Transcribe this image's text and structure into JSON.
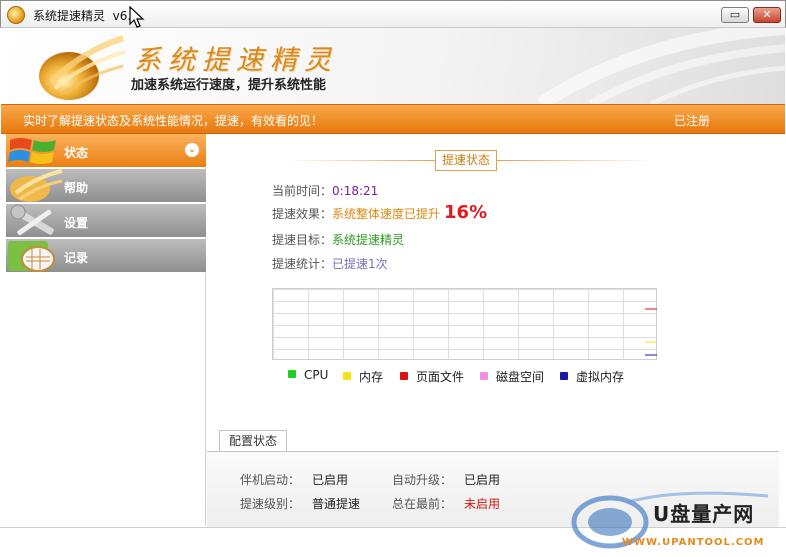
{
  "window": {
    "title": "系统提速精灵",
    "version": "v6.",
    "minimize_label": "▭",
    "close_label": "✕"
  },
  "banner": {
    "brand_calligraphy": "系统提速精灵",
    "tagline": "加速系统运行速度，提升系统性能"
  },
  "infobar": {
    "message": "实时了解提速状态及系统性能情况，提速，有效看的见！",
    "registration": "已注册"
  },
  "sidebar": {
    "items": [
      {
        "label": "状态",
        "active": true
      },
      {
        "label": "帮助",
        "active": false
      },
      {
        "label": "设置",
        "active": false
      },
      {
        "label": "记录",
        "active": false
      }
    ]
  },
  "status": {
    "tag": "提速状态",
    "time_label": "当前时间：",
    "time_value": "0:18:21",
    "effect_label": "提速效果：",
    "effect_value": "系统整体速度已提升",
    "effect_percent": "16%",
    "target_label": "提速目标：",
    "target_value": "系统提速精灵",
    "count_label": "提速统计：",
    "count_value": "已提速1次"
  },
  "legend": [
    {
      "label": "CPU",
      "color": "#22cc22"
    },
    {
      "label": "内存",
      "color": "#f2e21a"
    },
    {
      "label": "页面文件",
      "color": "#dd1111"
    },
    {
      "label": "磁盘空间",
      "color": "#f08ee0"
    },
    {
      "label": "虚拟内存",
      "color": "#1a1aa8"
    }
  ],
  "config": {
    "tab": "配置状态",
    "boot_label": "伴机启动：",
    "boot_value": "已启用",
    "autoupdate_label": "自动升级：",
    "autoupdate_value": "已启用",
    "level_label": "提速级别：",
    "level_value": "普通提速",
    "ontop_label": "总在最前：",
    "ontop_value": "未启用"
  },
  "watermark": {
    "text": "U盘量产网",
    "url": "WWW.UPANTOOL.COM"
  }
}
